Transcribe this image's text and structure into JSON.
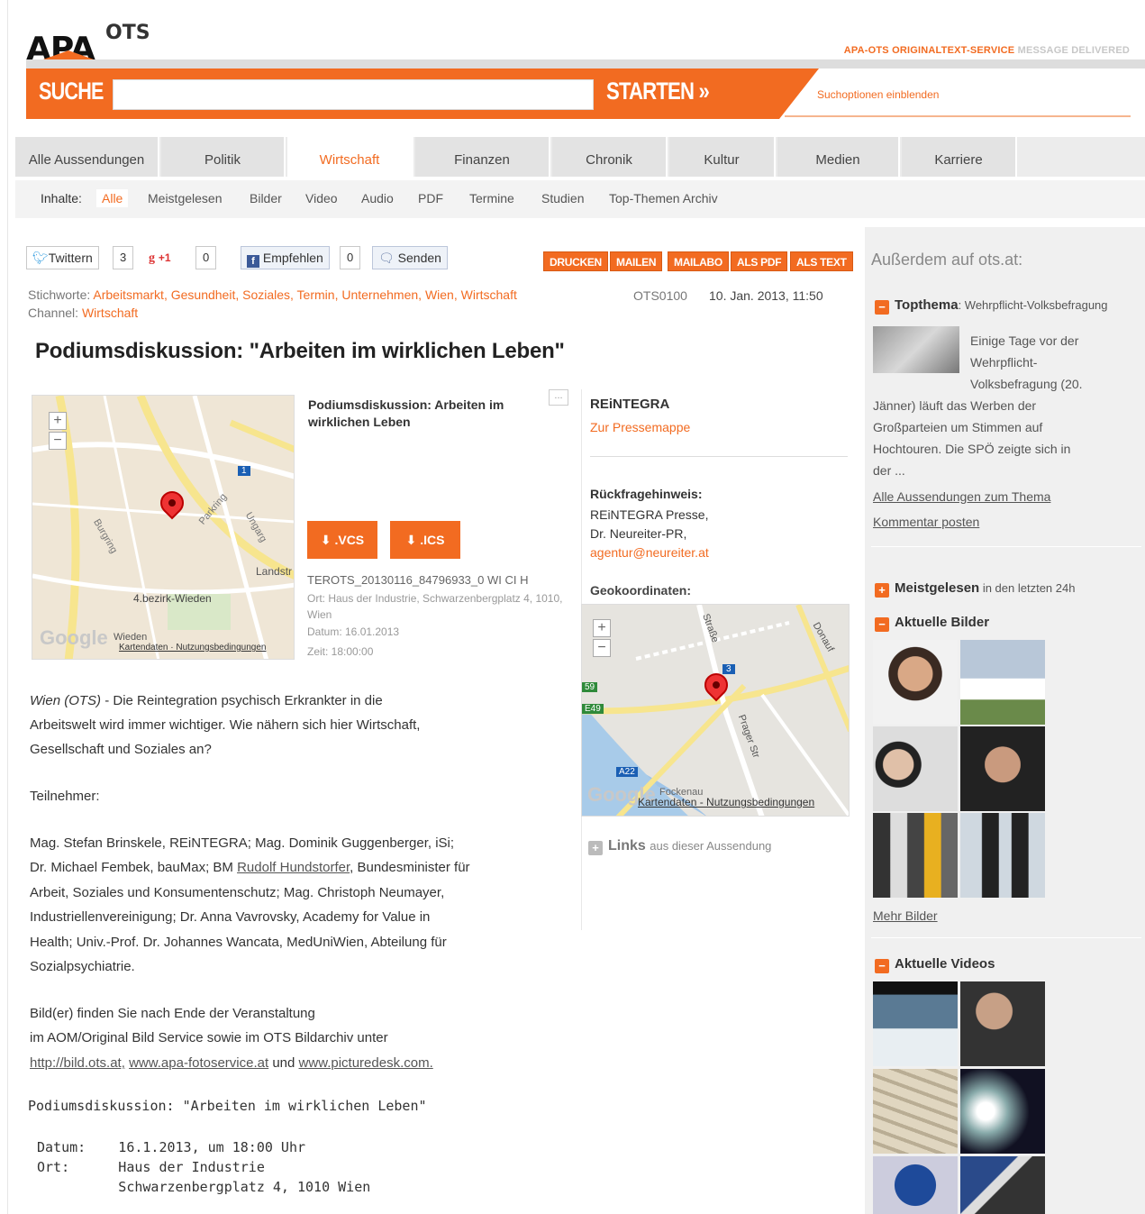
{
  "header": {
    "logo_apa": "APA",
    "logo_ots": "OTS",
    "tagline_a": "APA-OTS ORIGINALTEXT-SERVICE",
    "tagline_b": "MESSAGE DELIVERED"
  },
  "search": {
    "label": "SUCHE",
    "button": "STARTEN",
    "button_arrows": "»",
    "options": "Suchoptionen einblenden",
    "value": ""
  },
  "nav": [
    "Alle Aussendungen",
    "Politik",
    "Wirtschaft",
    "Finanzen",
    "Chronik",
    "Kultur",
    "Medien",
    "Karriere"
  ],
  "subnav": {
    "label": "Inhalte:",
    "items": [
      "Alle",
      "Meistgelesen",
      "Bilder",
      "Video",
      "Audio",
      "PDF",
      "Termine",
      "Studien",
      "Top-Themen Archiv"
    ]
  },
  "social": {
    "twitter": "Twittern",
    "twitter_count": "3",
    "gplus": "+1",
    "gplus_count": "0",
    "fb": "Empfehlen",
    "fb_count": "0",
    "send": "Senden"
  },
  "actions": [
    "DRUCKEN",
    "MAILEN",
    "MAILABO",
    "ALS PDF",
    "ALS TEXT"
  ],
  "meta": {
    "stichworte_label": "Stichworte:",
    "stichworte": "Arbeitsmarkt, Gesundheit, Soziales, Termin, Unternehmen, Wien, Wirtschaft",
    "ots_id": "OTS0100",
    "date": "10. Jan. 2013, 11:50",
    "channel_label": "Channel:",
    "channel": "Wirtschaft"
  },
  "title": "Podiumsdiskussion: \"Arbeiten im wirklichen Leben\"",
  "event": {
    "title": "Podiumsdiskussion: Arbeiten im wirklichen Leben",
    "vcs": ".VCS",
    "ics": ".ICS",
    "more": "...",
    "code": "TEROTS_20130116_84796933_0 WI CI H",
    "ort": "Ort: Haus der Industrie, Schwarzenbergplatz 4, 1010, Wien",
    "datum": "Datum: 16.01.2013",
    "zeit": "Zeit: 18:00:00"
  },
  "map1": {
    "plus": "+",
    "minus": "−",
    "google": "Google",
    "credits": "Kartendaten · Nutzungsbedingungen",
    "l1": "4.bezirk-Wieden",
    "l2": "Wieden",
    "l3": "Landstr",
    "l4": "Burgring",
    "l5": "Parkring",
    "l6": "Ungarg",
    "badge": "1"
  },
  "org": {
    "name": "REiNTEGRA",
    "link": "Zur Pressemappe",
    "rf_label": "Rückfragehinweis:",
    "rf1": "REiNTEGRA Presse,",
    "rf2": "Dr. Neureiter-PR,",
    "rf_mail": "agentur@neureiter.at",
    "geo_label": "Geokoordinaten:"
  },
  "map2": {
    "plus": "+",
    "minus": "−",
    "google": "Google",
    "credits": "Kartendaten - Nutzungsbedingungen",
    "l1": "Straße",
    "l2": "Prager Str",
    "l3": "Donauf",
    "l4": "Fockenau",
    "l5": "A22",
    "l6": "E49",
    "l7": "59",
    "badge": "3"
  },
  "links": {
    "label": "Links",
    "suffix": "aus dieser Aussendung"
  },
  "body": {
    "p1a": "Wien (OTS)",
    "p1b": " - Die Reintegration psychisch Erkrankter in die",
    "p1c": "Arbeitswelt wird immer wichtiger. Wie nähern sich hier Wirtschaft,",
    "p1d": "Gesellschaft und Soziales an?",
    "p2": "Teilnehmer:",
    "p3a": "Mag. Stefan Brinskele, REiNTEGRA; Mag. Dominik Guggenberger, iSi;",
    "p3b1": "Dr. Michael Fembek, bauMax; BM ",
    "p3b_link": "Rudolf Hundstorfer",
    "p3b2": ", Bundesminister für",
    "p3c": "Arbeit, Soziales und Konsumentenschutz; Mag. Christoph Neumayer,",
    "p3d": "Industriellenvereinigung; Dr. Anna Vavrovsky, Academy for Value in",
    "p3e": "Health; Univ.-Prof. Dr. Johannes Wancata, MedUniWien, Abteilung für",
    "p3f": "Sozialpsychiatrie.",
    "p4a": "Bild(er) finden Sie nach Ende der Veranstaltung",
    "p4b": "im AOM/Original Bild Service sowie im OTS Bildarchiv unter",
    "l1": "http://bild.ots.at,",
    "l2": "www.apa-fotoservice.at",
    "und": " und ",
    "l3": "www.picturedesk.com.",
    "m1": "Podiumsdiskussion: \"Arbeiten im wirklichen Leben\"",
    "m2": "Datum:    16.1.2013, um 18:00 Uhr",
    "m3": "Ort:      Haus der Industrie",
    "m4": "          Schwarzenbergplatz 4, 1010 Wien"
  },
  "sidebar": {
    "heading": "Außerdem auf ots.at:",
    "top_label": "Topthema",
    "top_topic": ": Wehrpflicht-Volksbefragung",
    "top_t1": "Einige Tage vor der",
    "top_t2": "Wehrpflicht-",
    "top_t3": "Volksbefragung (20.",
    "top_t4": "Jänner) läuft das Werben der",
    "top_t5": "Großparteien um Stimmen auf",
    "top_t6": "Hochtouren. Die SPÖ zeigte sich in",
    "top_t7": "der ...",
    "link1": "Alle Aussendungen zum Thema",
    "link2": "Kommentar posten",
    "meist": "Meistgelesen",
    "meist_sub": " in den letzten 24h",
    "bilder": "Aktuelle Bilder",
    "mehr": "Mehr Bilder",
    "videos": "Aktuelle Videos",
    "box_plus": "+",
    "box_minus": "−"
  }
}
